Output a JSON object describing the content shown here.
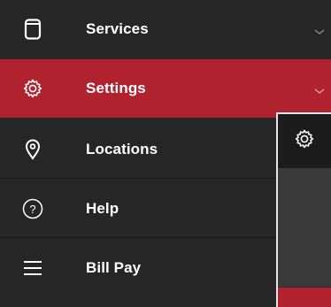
{
  "menu": {
    "items": [
      {
        "label": "Services",
        "icon": "phone-icon",
        "active": false,
        "has_submenu": true
      },
      {
        "label": "Settings",
        "icon": "gear-icon",
        "active": true,
        "has_submenu": true
      },
      {
        "label": "Locations",
        "icon": "location-pin-icon",
        "active": false,
        "has_submenu": false
      },
      {
        "label": "Help",
        "icon": "help-circle-icon",
        "active": false,
        "has_submenu": false
      },
      {
        "label": "Bill Pay",
        "icon": "menu-lines-icon",
        "active": false,
        "has_submenu": false
      }
    ]
  },
  "flyout": {
    "icon": "gear-icon"
  },
  "colors": {
    "background": "#262626",
    "active": "#b0222d",
    "text": "#ffffff",
    "chevron": "#8c8c8c"
  }
}
